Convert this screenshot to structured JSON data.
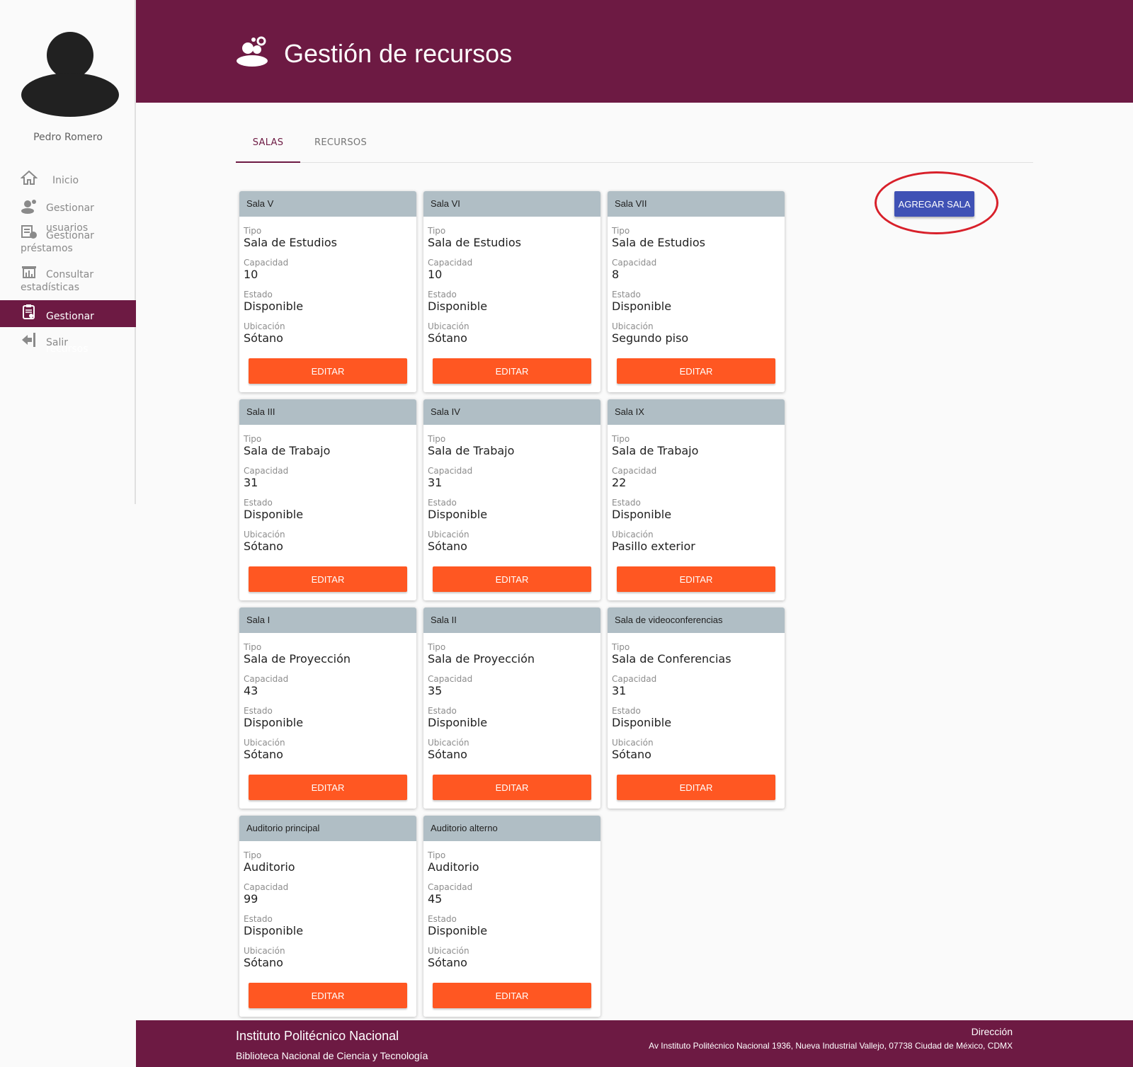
{
  "user": {
    "name": "Pedro Romero"
  },
  "nav": [
    {
      "label": "Inicio",
      "icon": "home-icon"
    },
    {
      "label": "Gestionar usuarios",
      "icon": "users-icon"
    },
    {
      "label_1": "Gestionar",
      "label_2": "préstamos",
      "icon": "loans-icon"
    },
    {
      "label_1": "Consultar",
      "label_2": "estadísticas",
      "icon": "stats-icon"
    },
    {
      "label": "Gestionar recursos",
      "icon": "resources-icon"
    },
    {
      "label": "Salir",
      "icon": "logout-icon"
    }
  ],
  "header": {
    "title": "Gestión de recursos",
    "icon": "resources-group-icon"
  },
  "tabs": [
    {
      "label": "SALAS"
    },
    {
      "label": "RECURSOS"
    }
  ],
  "active_tab": "SALAS",
  "add_button": "AGREGAR SALA",
  "field_labels": {
    "tipo": "Tipo",
    "capacidad": "Capacidad",
    "estado": "Estado",
    "ubicacion": "Ubicación"
  },
  "edit_label": "EDITAR",
  "rooms": [
    {
      "name": "Sala V",
      "tipo": "Sala de Estudios",
      "capacidad": "10",
      "estado": "Disponible",
      "ubicacion": "Sótano"
    },
    {
      "name": "Sala VI",
      "tipo": "Sala de Estudios",
      "capacidad": "10",
      "estado": "Disponible",
      "ubicacion": "Sótano"
    },
    {
      "name": "Sala VII",
      "tipo": "Sala de Estudios",
      "capacidad": "8",
      "estado": "Disponible",
      "ubicacion": "Segundo piso"
    },
    {
      "name": "Sala III",
      "tipo": "Sala de Trabajo",
      "capacidad": "31",
      "estado": "Disponible",
      "ubicacion": "Sótano"
    },
    {
      "name": "Sala IV",
      "tipo": "Sala de Trabajo",
      "capacidad": "31",
      "estado": "Disponible",
      "ubicacion": "Sótano"
    },
    {
      "name": "Sala IX",
      "tipo": "Sala de Trabajo",
      "capacidad": "22",
      "estado": "Disponible",
      "ubicacion": "Pasillo exterior"
    },
    {
      "name": "Sala I",
      "tipo": "Sala de Proyección",
      "capacidad": "43",
      "estado": "Disponible",
      "ubicacion": "Sótano"
    },
    {
      "name": "Sala II",
      "tipo": "Sala de Proyección",
      "capacidad": "35",
      "estado": "Disponible",
      "ubicacion": "Sótano"
    },
    {
      "name": "Sala de videoconferencias",
      "tipo": "Sala de Conferencias",
      "capacidad": "31",
      "estado": "Disponible",
      "ubicacion": "Sótano"
    },
    {
      "name": "Auditorio principal",
      "tipo": "Auditorio",
      "capacidad": "99",
      "estado": "Disponible",
      "ubicacion": "Sótano"
    },
    {
      "name": "Auditorio alterno",
      "tipo": "Auditorio",
      "capacidad": "45",
      "estado": "Disponible",
      "ubicacion": "Sótano"
    }
  ],
  "footer": {
    "institution": "Instituto Politécnico Nacional",
    "library": "Biblioteca Nacional de Ciencia y Tecnología",
    "address_label": "Dirección",
    "address": "Av Instituto Politécnico Nacional 1936, Nueva Industrial Vallejo, 07738 Ciudad de México, CDMX"
  },
  "colors": {
    "brand": "#6d1a43",
    "primary": "#3f51b5",
    "accent": "#ff5722",
    "card_header": "#b0bec5",
    "highlight": "#d8202a"
  }
}
